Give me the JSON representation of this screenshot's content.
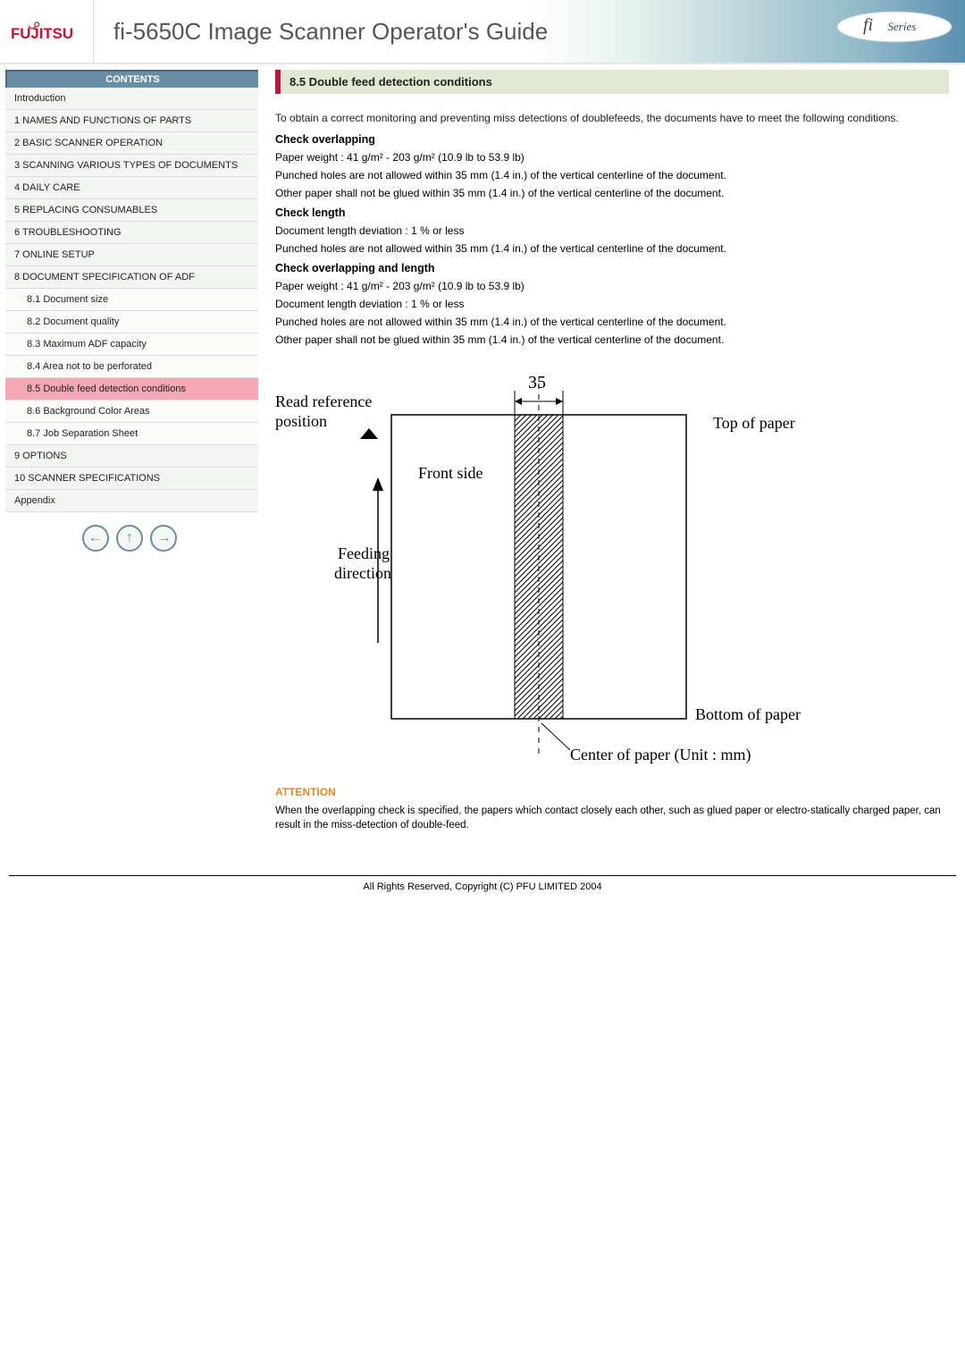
{
  "header": {
    "brand_alt": "FUJITSU",
    "title": "fi-5650C Image Scanner Operator's Guide",
    "series_label": "fi Series"
  },
  "sidebar": {
    "contents_label": "CONTENTS",
    "items": [
      {
        "label": "Introduction",
        "sub": false
      },
      {
        "label": "1 NAMES AND FUNCTIONS OF PARTS",
        "sub": false
      },
      {
        "label": "2 BASIC SCANNER OPERATION",
        "sub": false
      },
      {
        "label": "3 SCANNING VARIOUS TYPES OF DOCUMENTS",
        "sub": false
      },
      {
        "label": "4 DAILY CARE",
        "sub": false
      },
      {
        "label": "5 REPLACING CONSUMABLES",
        "sub": false
      },
      {
        "label": "6 TROUBLESHOOTING",
        "sub": false
      },
      {
        "label": "7 ONLINE SETUP",
        "sub": false
      },
      {
        "label": "8 DOCUMENT SPECIFICATION OF ADF",
        "sub": false
      },
      {
        "label": "8.1 Document size",
        "sub": true
      },
      {
        "label": "8.2 Document quality",
        "sub": true
      },
      {
        "label": "8.3 Maximum ADF capacity",
        "sub": true
      },
      {
        "label": "8.4 Area not to be perforated",
        "sub": true
      },
      {
        "label": "8.5 Double feed detection conditions",
        "sub": true,
        "active": true
      },
      {
        "label": "8.6 Background Color Areas",
        "sub": true
      },
      {
        "label": "8.7 Job Separation Sheet",
        "sub": true
      },
      {
        "label": "9 OPTIONS",
        "sub": false
      },
      {
        "label": "10 SCANNER SPECIFICATIONS",
        "sub": false
      },
      {
        "label": "Appendix",
        "sub": false
      }
    ],
    "nav": {
      "prev": "←",
      "up": "↑",
      "next": "→"
    }
  },
  "main": {
    "section_title": "8.5 Double feed detection conditions",
    "intro": "To obtain a correct monitoring and preventing miss detections of doublefeeds, the documents have to meet the following conditions.",
    "blocks": [
      {
        "heading": "Check overlapping",
        "paras": [
          "Paper weight : 41 g/m² - 203 g/m² (10.9 lb to 53.9 lb)",
          "Punched holes are not allowed within 35 mm (1.4 in.) of the vertical centerline of the document.",
          "Other paper shall not be glued within 35 mm (1.4 in.) of the vertical centerline of the document."
        ]
      },
      {
        "heading": "Check length",
        "paras": [
          "Document length deviation : 1 % or less",
          "Punched holes are not allowed within 35 mm (1.4 in.) of the vertical centerline of the document."
        ]
      },
      {
        "heading": "Check overlapping and length",
        "paras": [
          "Paper weight : 41 g/m² - 203 g/m² (10.9 lb to 53.9 lb)",
          "Document length deviation : 1 % or less",
          "Punched holes are not allowed within 35 mm (1.4 in.) of the vertical centerline of the document.",
          "Other paper shall not be glued within 35 mm (1.4 in.) of the vertical centerline of the document."
        ]
      }
    ],
    "diagram": {
      "read_ref_1": "Read reference",
      "read_ref_2": "position",
      "dim_35": "35",
      "front_side": "Front side",
      "feeding_1": "Feeding",
      "feeding_2": "direction",
      "top_of_paper": "Top of paper",
      "bottom_of_paper": "Bottom of paper",
      "center_of_paper": "Center of paper  (Unit : mm)"
    },
    "attention_label": "ATTENTION",
    "attention_body": "When the overlapping check is specified, the papers which contact closely each other, such as glued paper or electro-statically charged paper, can result in the miss-detection of double-feed."
  },
  "footer": {
    "copyright": "All Rights Reserved, Copyright (C) PFU LIMITED 2004"
  }
}
